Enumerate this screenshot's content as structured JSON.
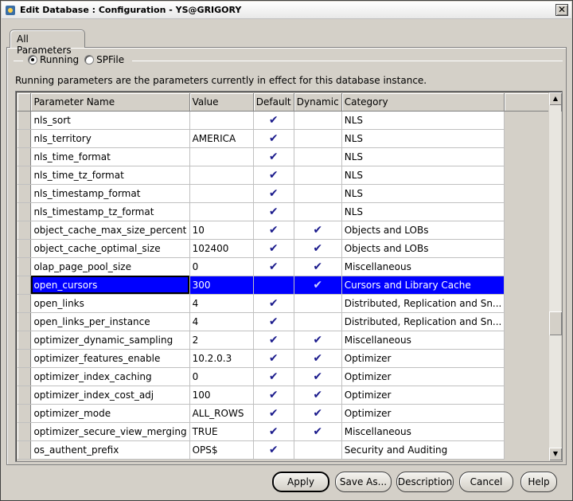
{
  "window": {
    "title": "Edit Database : Configuration - YS@GRIGORY",
    "close_glyph": "✕"
  },
  "tabs": [
    {
      "label": "All Parameters"
    }
  ],
  "mode": {
    "running_label": "Running",
    "spfile_label": "SPFile",
    "selected": "Running"
  },
  "description": "Running parameters are the parameters currently in effect for this database instance.",
  "grid": {
    "columns": [
      "Parameter Name",
      "Value",
      "Default",
      "Dynamic",
      "Category"
    ],
    "check_glyph": "✔",
    "rows": [
      {
        "name": "nls_sort",
        "value": "",
        "default": true,
        "dynamic": false,
        "category": "NLS"
      },
      {
        "name": "nls_territory",
        "value": "AMERICA",
        "default": true,
        "dynamic": false,
        "category": "NLS"
      },
      {
        "name": "nls_time_format",
        "value": "",
        "default": true,
        "dynamic": false,
        "category": "NLS"
      },
      {
        "name": "nls_time_tz_format",
        "value": "",
        "default": true,
        "dynamic": false,
        "category": "NLS"
      },
      {
        "name": "nls_timestamp_format",
        "value": "",
        "default": true,
        "dynamic": false,
        "category": "NLS"
      },
      {
        "name": "nls_timestamp_tz_format",
        "value": "",
        "default": true,
        "dynamic": false,
        "category": "NLS"
      },
      {
        "name": "object_cache_max_size_percent",
        "value": "10",
        "default": true,
        "dynamic": true,
        "category": "Objects and LOBs"
      },
      {
        "name": "object_cache_optimal_size",
        "value": "102400",
        "default": true,
        "dynamic": true,
        "category": "Objects and LOBs"
      },
      {
        "name": "olap_page_pool_size",
        "value": "0",
        "default": true,
        "dynamic": true,
        "category": "Miscellaneous"
      },
      {
        "name": "open_cursors",
        "value": "300",
        "default": false,
        "dynamic": true,
        "category": "Cursors and Library Cache",
        "selected": true
      },
      {
        "name": "open_links",
        "value": "4",
        "default": true,
        "dynamic": false,
        "category": "Distributed, Replication and Sn..."
      },
      {
        "name": "open_links_per_instance",
        "value": "4",
        "default": true,
        "dynamic": false,
        "category": "Distributed, Replication and Sn..."
      },
      {
        "name": "optimizer_dynamic_sampling",
        "value": "2",
        "default": true,
        "dynamic": true,
        "category": "Miscellaneous"
      },
      {
        "name": "optimizer_features_enable",
        "value": "10.2.0.3",
        "default": true,
        "dynamic": true,
        "category": "Optimizer"
      },
      {
        "name": "optimizer_index_caching",
        "value": "0",
        "default": true,
        "dynamic": true,
        "category": "Optimizer"
      },
      {
        "name": "optimizer_index_cost_adj",
        "value": "100",
        "default": true,
        "dynamic": true,
        "category": "Optimizer"
      },
      {
        "name": "optimizer_mode",
        "value": "ALL_ROWS",
        "default": true,
        "dynamic": true,
        "category": "Optimizer"
      },
      {
        "name": "optimizer_secure_view_merging",
        "value": "TRUE",
        "default": true,
        "dynamic": true,
        "category": "Miscellaneous"
      },
      {
        "name": "os_authent_prefix",
        "value": "OPS$",
        "default": true,
        "dynamic": false,
        "category": "Security and Auditing"
      }
    ]
  },
  "scrollbar": {
    "up_glyph": "▲",
    "down_glyph": "▼"
  },
  "buttons": {
    "apply": "Apply",
    "save_as": "Save As...",
    "description": "Description",
    "cancel": "Cancel",
    "help": "Help"
  }
}
